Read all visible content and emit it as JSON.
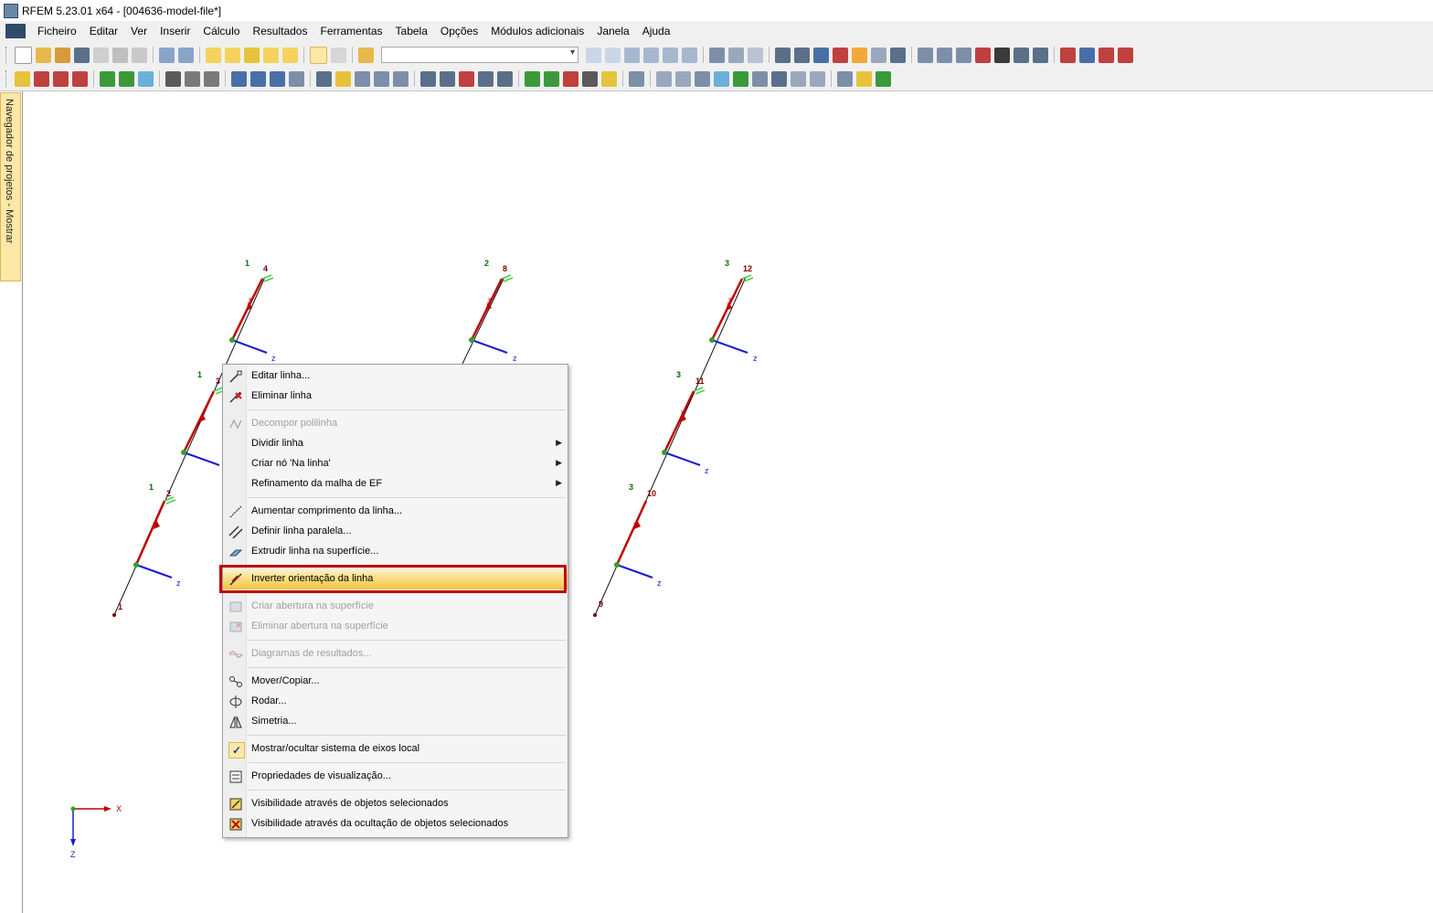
{
  "window": {
    "title": "RFEM 5.23.01 x64 - [004636-model-file*]",
    "app_icon": "rfem-app-icon"
  },
  "menubar": {
    "items": [
      "Ficheiro",
      "Editar",
      "Ver",
      "Inserir",
      "Cálculo",
      "Resultados",
      "Ferramentas",
      "Tabela",
      "Opções",
      "Módulos adicionais",
      "Janela",
      "Ajuda"
    ]
  },
  "toolbar": {
    "combo_value": ""
  },
  "navigator_tab": {
    "label": "Navegador de projetos - Mostrar"
  },
  "model": {
    "column1": {
      "member_labels": [
        "1",
        "1",
        "1"
      ],
      "node_labels": [
        "4",
        "3",
        "2",
        "1"
      ],
      "axis_labels": [
        "z",
        "z",
        "z"
      ],
      "x_labels": [
        "x",
        "x",
        "x"
      ]
    },
    "column2": {
      "member_labels": [
        "2"
      ],
      "node_labels": [
        "8"
      ],
      "axis_labels": [
        "z"
      ],
      "x_labels": [
        "x"
      ]
    },
    "column3": {
      "member_labels": [
        "3",
        "3",
        "3"
      ],
      "node_labels": [
        "12",
        "11",
        "10",
        "9"
      ],
      "axis_labels": [
        "z",
        "z",
        "z"
      ],
      "x_labels": [
        "x",
        "x",
        "x"
      ]
    },
    "global_axes": {
      "x": "X",
      "z": "Z"
    },
    "colors": {
      "member_red": "#c00000",
      "axis_blue": "#1a1ad0",
      "node_green": "#2aa32a",
      "member_label_green": "#0a6a0a",
      "node_label_red": "#7a0000"
    }
  },
  "context_menu": {
    "items": [
      {
        "label": "Editar linha...",
        "icon": "edit-line-icon",
        "enabled": true
      },
      {
        "label": "Eliminar linha",
        "icon": "delete-line-icon",
        "enabled": true
      },
      {
        "label": "Decompor polilinha",
        "icon": "decompose-polyline-icon",
        "enabled": false
      },
      {
        "label": "Dividir linha",
        "icon": "",
        "enabled": true,
        "submenu": true
      },
      {
        "label": "Criar nó 'Na linha'",
        "icon": "",
        "enabled": true,
        "submenu": true
      },
      {
        "label": "Refinamento da malha de EF",
        "icon": "",
        "enabled": true,
        "submenu": true
      },
      {
        "label": "Aumentar comprimento da linha...",
        "icon": "extend-line-icon",
        "enabled": true
      },
      {
        "label": "Definir linha paralela...",
        "icon": "parallel-line-icon",
        "enabled": true
      },
      {
        "label": "Extrudir linha na superfície...",
        "icon": "extrude-line-icon",
        "enabled": true
      },
      {
        "label": "Inverter orientação da linha",
        "icon": "reverse-orientation-icon",
        "enabled": true,
        "highlighted": true
      },
      {
        "label": "Criar abertura na superfície",
        "icon": "create-opening-icon",
        "enabled": false
      },
      {
        "label": "Eliminar abertura na superfície",
        "icon": "delete-opening-icon",
        "enabled": false
      },
      {
        "label": "Diagramas de resultados...",
        "icon": "result-diagrams-icon",
        "enabled": false
      },
      {
        "label": "Mover/Copiar...",
        "icon": "move-copy-icon",
        "enabled": true
      },
      {
        "label": "Rodar...",
        "icon": "rotate-icon",
        "enabled": true
      },
      {
        "label": "Simetria...",
        "icon": "mirror-icon",
        "enabled": true
      },
      {
        "label": "Mostrar/ocultar sistema de eixos local",
        "icon": "checkmark-icon",
        "enabled": true,
        "checked": true
      },
      {
        "label": "Propriedades de visualização...",
        "icon": "display-properties-icon",
        "enabled": true
      },
      {
        "label": "Visibilidade através de objetos selecionados",
        "icon": "visibility-selected-icon",
        "enabled": true
      },
      {
        "label": "Visibilidade através da ocultação de objetos selecionados",
        "icon": "visibility-hide-selected-icon",
        "enabled": true
      }
    ]
  }
}
